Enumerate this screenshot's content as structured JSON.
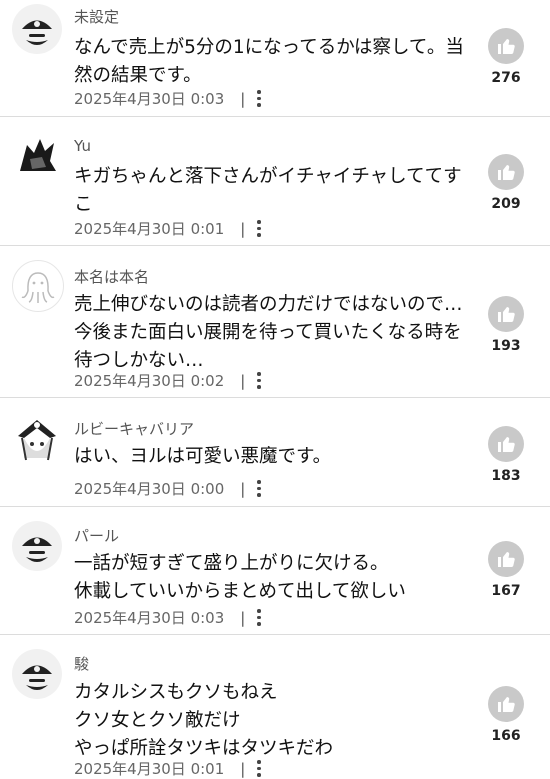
{
  "comments": [
    {
      "user": "未設定",
      "text": "なんで売上が5分の1になってるかは察して。当然の結果です。",
      "date": "2025年4月30日 0:03",
      "likes": "276",
      "avatar": "pirate-default-avatar-icon"
    },
    {
      "user": "Yu",
      "text": "キガちゃんと落下さんがイチャイチャしててすこ",
      "date": "2025年4月30日 0:01",
      "likes": "209",
      "avatar": "manga-character-avatar-icon"
    },
    {
      "user": "本名は本名",
      "text": "売上伸びないのは読者の力だけではないので…今後また面白い展開を待って買いたくなる時を待つしかない…",
      "date": "2025年4月30日 0:02",
      "likes": "193",
      "avatar": "octopus-avatar-icon"
    },
    {
      "user": "ルビーキャバリア",
      "text": "はい、ヨルは可愛い悪魔です。",
      "date": "2025年4月30日 0:00",
      "likes": "183",
      "avatar": "anime-girl-avatar-icon"
    },
    {
      "user": "パール",
      "text": "一話が短すぎて盛り上がりに欠ける。\n休載していいからまとめて出して欲しい",
      "date": "2025年4月30日 0:03",
      "likes": "167",
      "avatar": "pirate-default-avatar-icon"
    },
    {
      "user": "駿",
      "text": "カタルシスもクソもねえ\nクソ女とクソ敵だけ\nやっぱ所詮タツキはタツキだわ",
      "date": "2025年4月30日 0:01",
      "likes": "166",
      "avatar": "pirate-default-avatar-icon"
    }
  ]
}
